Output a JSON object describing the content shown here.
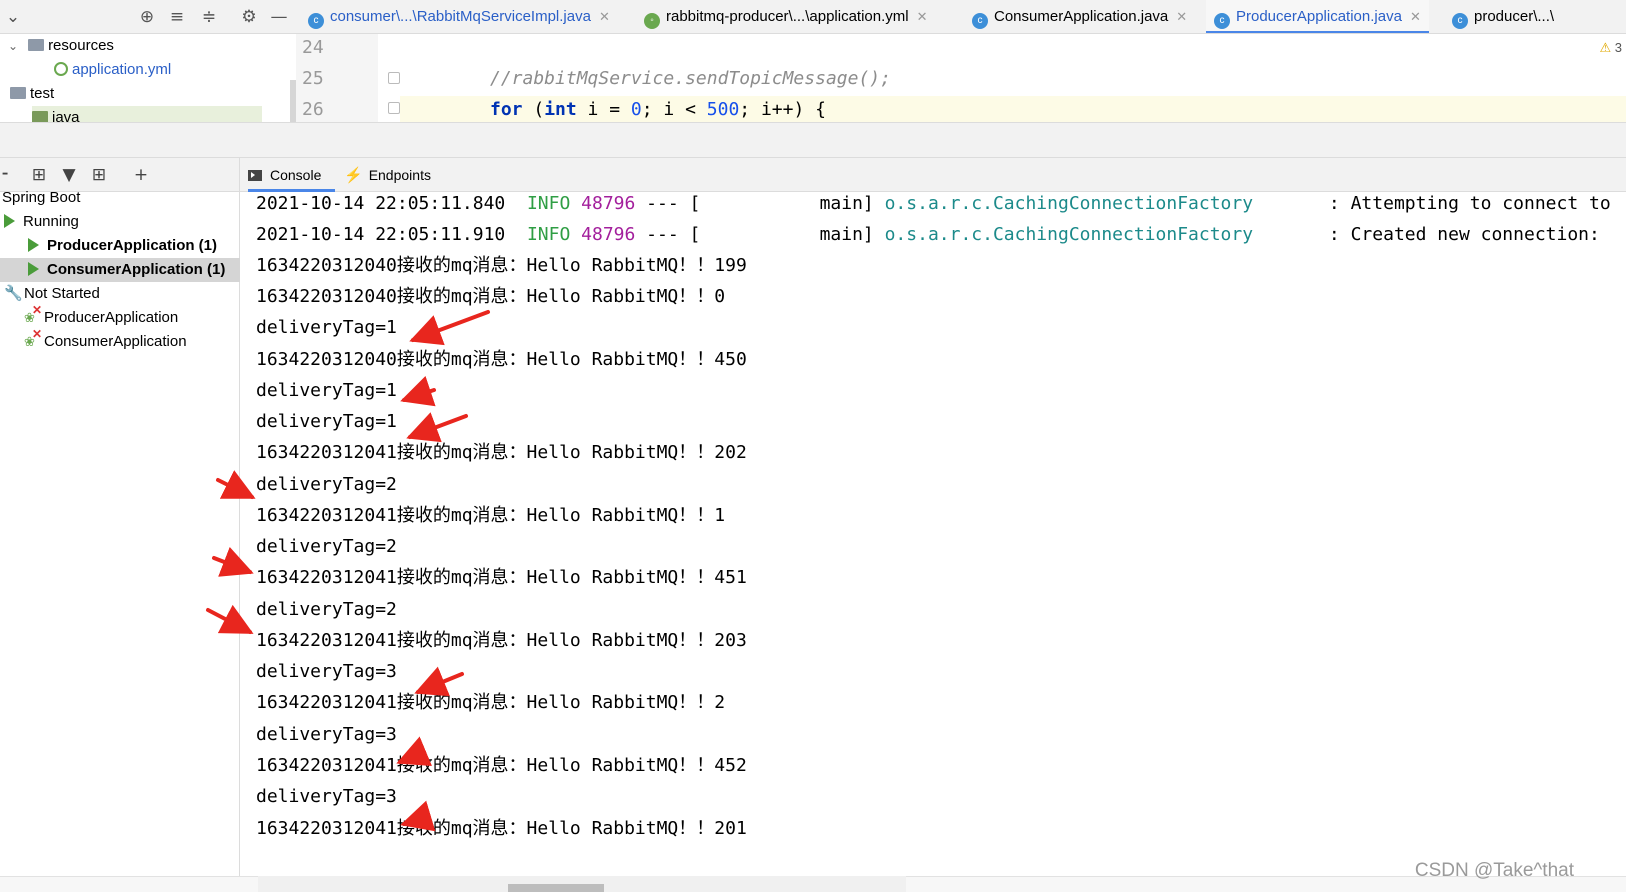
{
  "project_tree": {
    "items": [
      {
        "label": "resources",
        "type": "folder"
      },
      {
        "label": "application.yml",
        "type": "yml"
      },
      {
        "label": "test",
        "type": "folder"
      },
      {
        "label": "java",
        "type": "folder"
      }
    ]
  },
  "editor_tabs": [
    {
      "label": "consumer\\...\\RabbitMqServiceImpl.java",
      "icon": "class-icon"
    },
    {
      "label": "rabbitmq-producer\\...\\application.yml",
      "icon": "yml-icon"
    },
    {
      "label": "ConsumerApplication.java",
      "icon": "spring-class-icon"
    },
    {
      "label": "ProducerApplication.java",
      "icon": "spring-class-icon",
      "active": true
    },
    {
      "label": "producer\\...\\",
      "icon": "class-icon"
    }
  ],
  "editor": {
    "line_numbers": [
      "24",
      "25",
      "26"
    ],
    "line25": "//rabbitMqService.sendTopicMessage();",
    "line26": {
      "kw_for": "for",
      "open": " (",
      "kw_int": "int",
      "part1": " i = ",
      "zero": "0",
      "part2": "; i < ",
      "limit": "500",
      "part3": "; i++) {"
    },
    "warning_count": "3"
  },
  "services": {
    "root": "Spring Boot",
    "running": "Running",
    "running_items": [
      "ProducerApplication (1)",
      "ConsumerApplication (1)"
    ],
    "not_started": "Not Started",
    "not_started_items": [
      "ProducerApplication",
      "ConsumerApplication"
    ]
  },
  "console_tabs": {
    "console": "Console",
    "endpoints": "Endpoints"
  },
  "console": {
    "log_lines": [
      {
        "timestamp": "2021-10-14 22:05:11.840",
        "level": "INFO",
        "pid": "48796",
        "sep": " --- [",
        "thread": "           main]",
        "logger": "o.s.a.r.c.CachingConnectionFactory",
        "message": "       : Attempting to connect to"
      },
      {
        "timestamp": "2021-10-14 22:05:11.910",
        "level": "INFO",
        "pid": "48796",
        "sep": " --- [",
        "thread": "           main]",
        "logger": "o.s.a.r.c.CachingConnectionFactory",
        "message": "       : Created new connection:"
      }
    ],
    "output_lines": [
      "1634220312040接收的mq消息：Hello RabbitMQ！！199",
      "1634220312040接收的mq消息：Hello RabbitMQ！！0",
      "deliveryTag=1",
      "1634220312040接收的mq消息：Hello RabbitMQ！！450",
      "deliveryTag=1",
      "deliveryTag=1",
      "1634220312041接收的mq消息：Hello RabbitMQ！！202",
      "deliveryTag=2",
      "1634220312041接收的mq消息：Hello RabbitMQ！！1",
      "deliveryTag=2",
      "1634220312041接收的mq消息：Hello RabbitMQ！！451",
      "deliveryTag=2",
      "1634220312041接收的mq消息：Hello RabbitMQ！！203",
      "deliveryTag=3",
      "1634220312041接收的mq消息：Hello RabbitMQ！！2",
      "deliveryTag=3",
      "1634220312041接收的mq消息：Hello RabbitMQ！！452",
      "deliveryTag=3",
      "1634220312041接收的mq消息：Hello RabbitMQ！！201"
    ]
  },
  "watermark": "CSDN @Take^that",
  "colors": {
    "info": "#2f9e44",
    "pid": "#a31f9c",
    "logger": "#1c8a8a",
    "arrow": "#e8261e",
    "accent": "#4a86e8"
  }
}
